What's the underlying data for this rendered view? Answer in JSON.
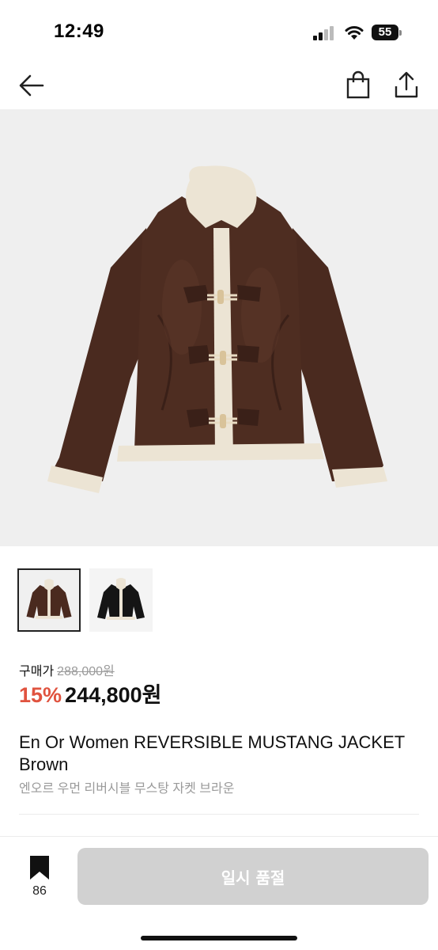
{
  "status_bar": {
    "time": "12:49",
    "battery": "55"
  },
  "nav": {
    "back_icon": "arrow-left",
    "bag_icon": "shopping-bag",
    "share_icon": "share-upload"
  },
  "product": {
    "price_label": "구매가",
    "original_price": "288,000원",
    "discount": "15%",
    "final_price": "244,800원",
    "title_en": "En Or Women REVERSIBLE MUSTANG JACKET Brown",
    "title_ko": "엔오르 우먼 리버시블 무스탕 자켓  브라운"
  },
  "thumbnails": [
    {
      "name": "brown-jacket",
      "selected": true
    },
    {
      "name": "black-jacket",
      "selected": false
    }
  ],
  "bottom_bar": {
    "bookmark_count": "86",
    "soldout_label": "일시 품절"
  },
  "colors": {
    "discount": "#e0533f",
    "button_disabled": "#d1d1d1",
    "jacket_brown": "#4a2a1f",
    "shearling": "#ece4d4"
  }
}
